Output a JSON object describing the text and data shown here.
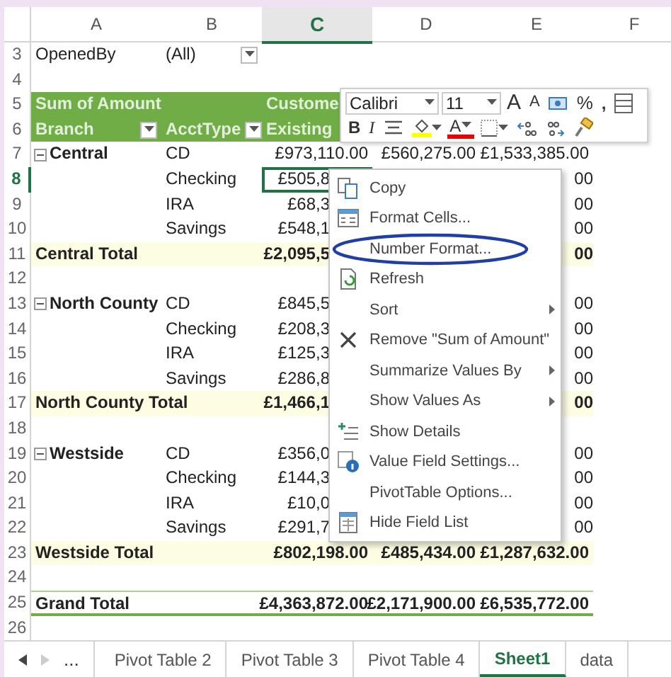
{
  "columns": [
    {
      "label": "A",
      "selected": false
    },
    {
      "label": "B",
      "selected": false
    },
    {
      "label": "C",
      "selected": true
    },
    {
      "label": "D",
      "selected": false
    },
    {
      "label": "E",
      "selected": false
    },
    {
      "label": "F",
      "selected": false
    }
  ],
  "rows": [
    {
      "row": "3",
      "kind": "filter",
      "a": "OpenedBy",
      "b": "(All)",
      "b_dropdown": true
    },
    {
      "row": "4",
      "kind": "blank"
    },
    {
      "row": "5",
      "kind": "header",
      "a": "Sum of Amount",
      "c": "Custome"
    },
    {
      "row": "6",
      "kind": "header",
      "a": "Branch",
      "a_dropdown": true,
      "b": "AcctType",
      "b_dropdown": true,
      "c": "Existing"
    },
    {
      "row": "7",
      "kind": "group",
      "a": "Central",
      "b": "CD",
      "c": "£973,110.00",
      "d": "£560,275.00",
      "e": "£1,533,385.00"
    },
    {
      "row": "8",
      "kind": "item",
      "b": "Checking",
      "c": "£505,8",
      "e": "00",
      "selected": true
    },
    {
      "row": "9",
      "kind": "item",
      "b": "IRA",
      "c": "£68,3",
      "e": "00"
    },
    {
      "row": "10",
      "kind": "item",
      "b": "Savings",
      "c": "£548,1",
      "e": "00"
    },
    {
      "row": "11",
      "kind": "subtotal",
      "a": "Central Total",
      "c": "£2,095,5",
      "e": "00"
    },
    {
      "row": "12",
      "kind": "blank"
    },
    {
      "row": "13",
      "kind": "group",
      "a": "North County",
      "b": "CD",
      "c": "£845,5",
      "e": "00"
    },
    {
      "row": "14",
      "kind": "item",
      "b": "Checking",
      "c": "£208,3",
      "e": "00"
    },
    {
      "row": "15",
      "kind": "item",
      "b": "IRA",
      "c": "£125,3",
      "e": "00"
    },
    {
      "row": "16",
      "kind": "item",
      "b": "Savings",
      "c": "£286,8",
      "e": "00"
    },
    {
      "row": "17",
      "kind": "subtotal",
      "a": "North County Total",
      "c": "£1,466,1",
      "e": "00"
    },
    {
      "row": "18",
      "kind": "blank"
    },
    {
      "row": "19",
      "kind": "group",
      "a": "Westside",
      "b": "CD",
      "c": "£356,0",
      "e": "00"
    },
    {
      "row": "20",
      "kind": "item",
      "b": "Checking",
      "c": "£144,3",
      "e": "00"
    },
    {
      "row": "21",
      "kind": "item",
      "b": "IRA",
      "c": "£10,0",
      "e": "00"
    },
    {
      "row": "22",
      "kind": "item",
      "b": "Savings",
      "c": "£291,7",
      "e": "00"
    },
    {
      "row": "23",
      "kind": "subtotal",
      "a": "Westside Total",
      "c": "£802,198.00",
      "d": "£485,434.00",
      "e": "£1,287,632.00"
    },
    {
      "row": "24",
      "kind": "blank"
    },
    {
      "row": "25",
      "kind": "grandtotal",
      "a": "Grand Total",
      "c": "£4,363,872.00",
      "d": "£2,171,900.00",
      "e": "£6,535,772.00"
    },
    {
      "row": "26",
      "kind": "blank"
    }
  ],
  "mini_toolbar": [
    [
      {
        "kind": "dropdown",
        "value": "Calibri"
      },
      {
        "kind": "dropdown",
        "value": "11"
      },
      {
        "kind": "grow-font",
        "label": "A"
      },
      {
        "kind": "shrink-font",
        "label": "A"
      },
      {
        "kind": "accounting"
      },
      {
        "kind": "percent",
        "label": "%"
      },
      {
        "kind": "comma",
        "label": ","
      },
      {
        "kind": "format-table"
      }
    ],
    [
      {
        "kind": "bold",
        "label": "B"
      },
      {
        "kind": "italic",
        "label": "I"
      },
      {
        "kind": "align"
      },
      {
        "kind": "fill-color"
      },
      {
        "kind": "font-color",
        "label": "A"
      },
      {
        "kind": "borders"
      },
      {
        "kind": "increase-decimal"
      },
      {
        "kind": "decrease-decimal"
      },
      {
        "kind": "format-painter"
      }
    ]
  ],
  "context_menu": [
    {
      "label": "Copy",
      "kind": "copy",
      "submenu": false,
      "circled": false
    },
    {
      "label": "Format Cells...",
      "kind": "format-cells",
      "submenu": false,
      "circled": false
    },
    {
      "label": "Number Format...",
      "kind": "plain",
      "submenu": false,
      "circled": true
    },
    {
      "label": "Refresh",
      "kind": "refresh",
      "submenu": false,
      "circled": false
    },
    {
      "label": "Sort",
      "kind": "plain",
      "submenu": true,
      "circled": false
    },
    {
      "label": "Remove \"Sum of Amount\"",
      "kind": "remove",
      "submenu": false,
      "circled": false
    },
    {
      "label": "Summarize Values By",
      "kind": "plain",
      "submenu": true,
      "circled": false
    },
    {
      "label": "Show Values As",
      "kind": "plain",
      "submenu": true,
      "circled": false
    },
    {
      "label": "Show Details",
      "kind": "show-details",
      "submenu": false,
      "circled": false
    },
    {
      "label": "Value Field Settings...",
      "kind": "field-settings",
      "submenu": false,
      "circled": false
    },
    {
      "label": "PivotTable Options...",
      "kind": "plain",
      "submenu": false,
      "circled": false
    },
    {
      "label": "Hide Field List",
      "kind": "field-list",
      "submenu": false,
      "circled": false
    }
  ],
  "sheet_nav": {
    "prev_disabled": false,
    "next_disabled": true,
    "more": "..."
  },
  "sheet_tabs": [
    {
      "label": "Pivot Table 2",
      "selected": false
    },
    {
      "label": "Pivot Table 3",
      "selected": false
    },
    {
      "label": "Pivot Table 4",
      "selected": false
    },
    {
      "label": "Sheet1",
      "selected": true
    },
    {
      "label": "data",
      "selected": false
    }
  ]
}
